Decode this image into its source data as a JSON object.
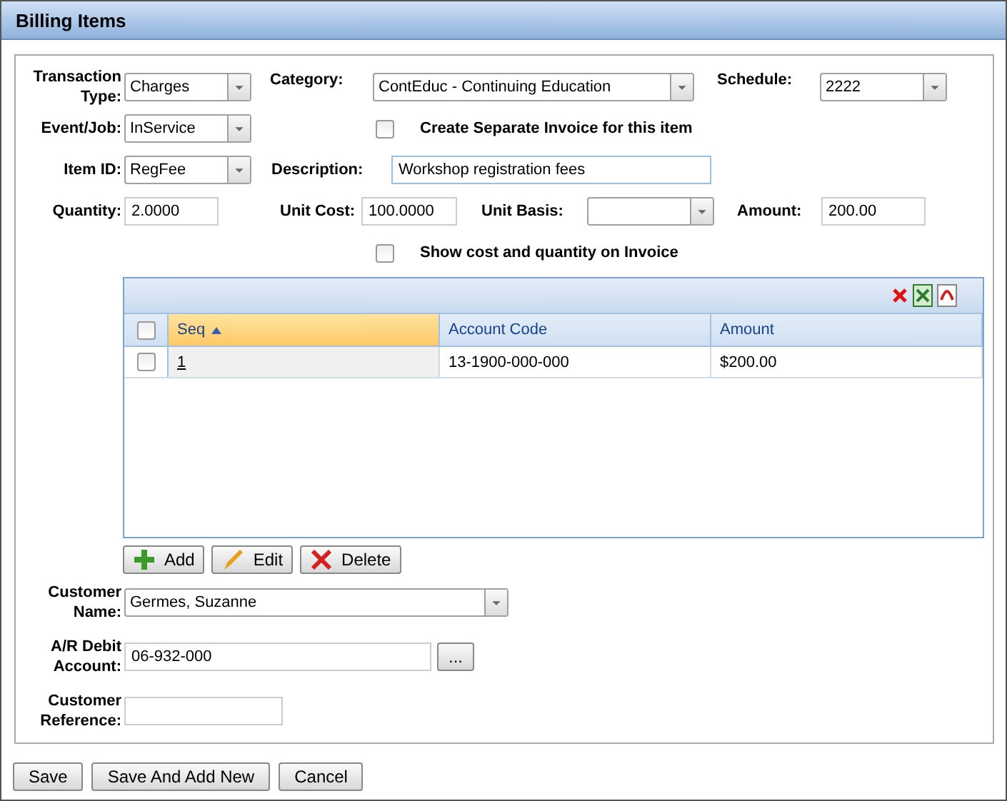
{
  "window": {
    "title": "Billing Items"
  },
  "transaction_type": {
    "label": "Transaction Type:",
    "value": "Charges"
  },
  "category": {
    "label": "Category:",
    "value": "ContEduc - Continuing Education"
  },
  "schedule": {
    "label": "Schedule:",
    "value": "2222"
  },
  "event_job": {
    "label": "Event/Job:",
    "value": "InService"
  },
  "separate_invoice": {
    "label": "Create Separate Invoice for this item",
    "checked": false
  },
  "item_id": {
    "label": "Item ID:",
    "value": "RegFee"
  },
  "description": {
    "label": "Description:",
    "value": "Workshop registration fees"
  },
  "quantity": {
    "label": "Quantity:",
    "value": "2.0000"
  },
  "unit_cost": {
    "label": "Unit Cost:",
    "value": "100.0000"
  },
  "unit_basis": {
    "label": "Unit Basis:"
  },
  "amount": {
    "label": "Amount:",
    "value": "200.00"
  },
  "show_cost": {
    "label": "Show cost and quantity on Invoice",
    "checked": false
  },
  "table": {
    "all_checked": false,
    "columns": [
      {
        "label": "Seq",
        "sorted": true
      },
      {
        "label": "Account Code",
        "sorted": false
      },
      {
        "label": "Amount",
        "sorted": false
      }
    ],
    "rows": [
      {
        "checked": false,
        "cells": [
          "1",
          "13-1900-000-000",
          "$200.00"
        ]
      }
    ]
  },
  "grid_buttons": [
    {
      "label": "Add",
      "kind": "add"
    },
    {
      "label": "Edit",
      "kind": "edit"
    },
    {
      "label": "Delete",
      "kind": "delete"
    }
  ],
  "customer_name": {
    "label": "Customer Name:",
    "value": "Germes, Suzanne"
  },
  "ar_debit": {
    "label": "A/R Debit Account:",
    "value": "06-932-000",
    "button": "..."
  },
  "customer_reference": {
    "label": "Customer Reference:"
  },
  "footer_buttons": [
    "Save",
    "Save And Add New",
    "Cancel"
  ]
}
